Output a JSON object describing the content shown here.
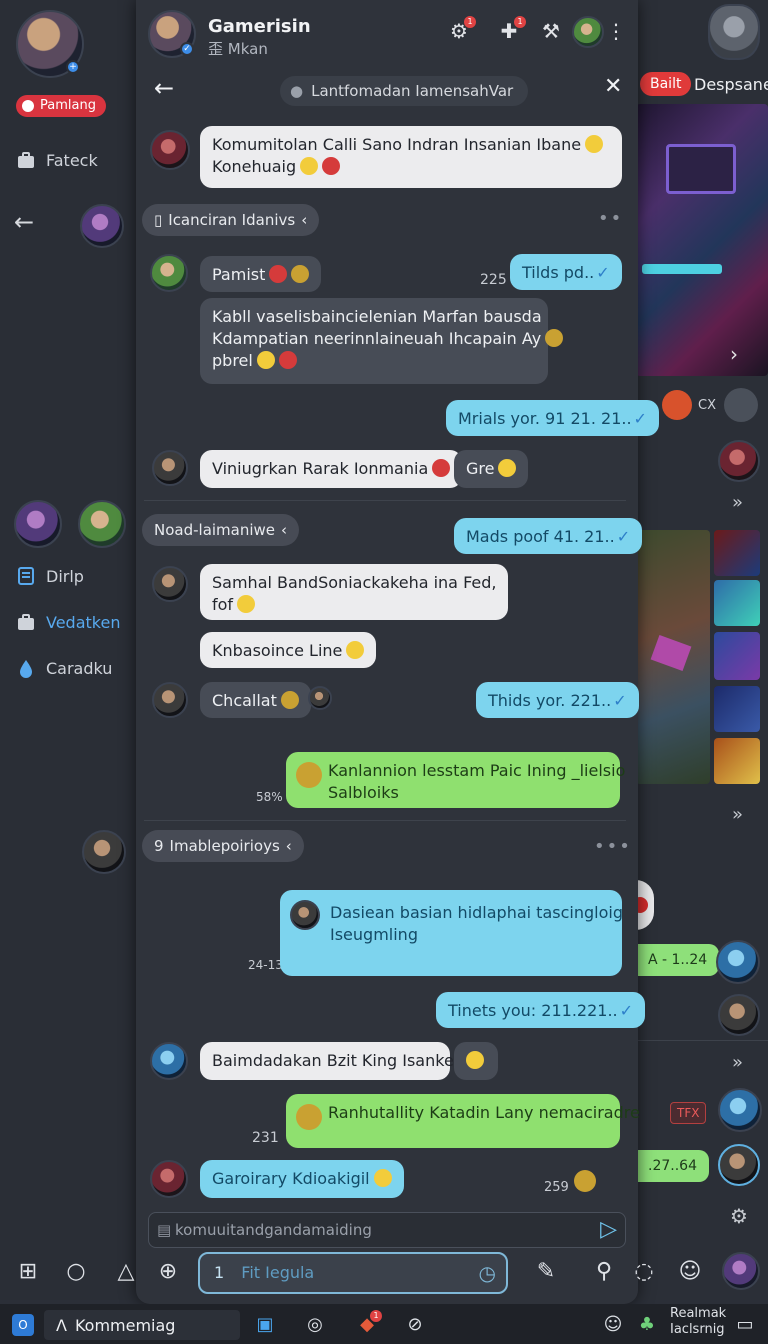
{
  "left": {
    "status_pill": "Pamlang",
    "items": [
      {
        "label": "Fateck",
        "icon": "briefcase-icon"
      },
      {
        "label": "Dirlp",
        "icon": "document-icon"
      },
      {
        "label": "Vedatken",
        "icon": "briefcase-icon"
      },
      {
        "label": "Caradku",
        "icon": "drop-icon"
      }
    ]
  },
  "chat": {
    "title": "Gamerisin",
    "subtitle": "歪 Mkan",
    "header_badge_1": "1",
    "header_badge_2": "1",
    "search_text": "Lantfomadan Iamensah​Var",
    "messages": {
      "m1": "Komumitolan Calli Sano Indran Insanian Ibane",
      "m1b": "Konehuaig",
      "section1": "Icanciran Idanivs",
      "m2_name": "Pamist",
      "m2_time": "225",
      "m2_reply": "Tilds pd..",
      "m3_l1": "Kabll vaselisbaincielenian Marfan bausda",
      "m3_l2": "Kdampatian neerinnlaineuah Ihcapain Ay",
      "m3_l3": "pbrel",
      "m4": "Mrials yor. 91 21. 21..",
      "m5": "Viniugrkan Rarak Ionmania",
      "m5b": "Gre",
      "section2": "Noad-laimaniwe",
      "m6": "Mads poof 41. 21..",
      "m7_l1": "Samhal BandSoniackakeha ina Fed,",
      "m7_l2": "fof",
      "m8": "Knbasoince Line",
      "m9": "Chcallat",
      "m10": "Thids yor. 221..",
      "m11_l1": "Kanlannion lesstam Paic Ining _lielsio",
      "m11_l2": "Salbloiks",
      "m11_time": "58%",
      "section3": "Imablepoirioys",
      "section3_prefix": "9",
      "m12_l1": "Dasiean basian hidlaphai tascingloig",
      "m12_l2": "Iseugmling",
      "m12_time": "24-13",
      "m13": "Tinets you: 211.221..",
      "m14": "Baimdadakan Bzit King Isankel",
      "m15": "Ranhutallity Katadin Lany nemaciradre",
      "m15_time": "231",
      "m16": "Garoirary Kdioakigil",
      "m16_time": "259"
    },
    "input_placeholder": "komuuitandgandamaiding",
    "compose_value": "1",
    "compose_placeholder": "Fit Iegula"
  },
  "right": {
    "tab_badge": "Bailt",
    "tab_label": "Despsane",
    "pill1": "A - 1..24",
    "pill2": ".27..64",
    "fx_badge": "TFX"
  },
  "taskbar": {
    "start_label": "O",
    "app_label": "Kommemiag",
    "notify_badge": "1",
    "right_l1": "Realmak",
    "right_l2": "Iaclsrnig"
  },
  "colors": {
    "bg": "#2b2f38",
    "bubble_cyan": "#7dd4ee",
    "bubble_green": "#8fe06f",
    "accent_blue": "#58a9ee",
    "alert_red": "#d9343f"
  }
}
